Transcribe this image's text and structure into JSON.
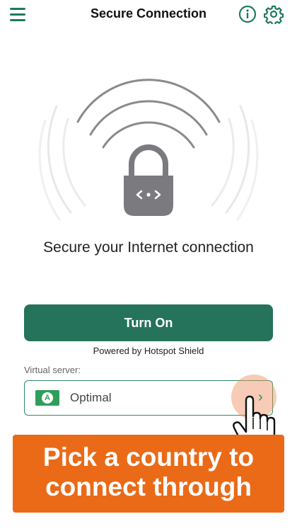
{
  "header": {
    "title": "Secure Connection",
    "menu_icon": "hamburger-menu-icon",
    "info_icon": "info-icon",
    "settings_icon": "gear-icon"
  },
  "hero": {
    "icon": "lock-with-signal-waves-icon",
    "tagline": "Secure your Internet connection"
  },
  "connect": {
    "button_label": "Turn On",
    "powered_by": "Powered by Hotspot Shield"
  },
  "server": {
    "label": "Virtual server:",
    "flag_letter": "A",
    "selected": "Optimal",
    "chevron": "›"
  },
  "overlay": {
    "hand_icon": "pointing-hand-cursor-icon",
    "banner_line1": "Pick a country to",
    "banner_line2": "connect through"
  },
  "colors": {
    "accent": "#25735a",
    "banner": "#ea6a17",
    "tap_highlight": "#ee8c5a",
    "lock": "#7b7b7f"
  }
}
